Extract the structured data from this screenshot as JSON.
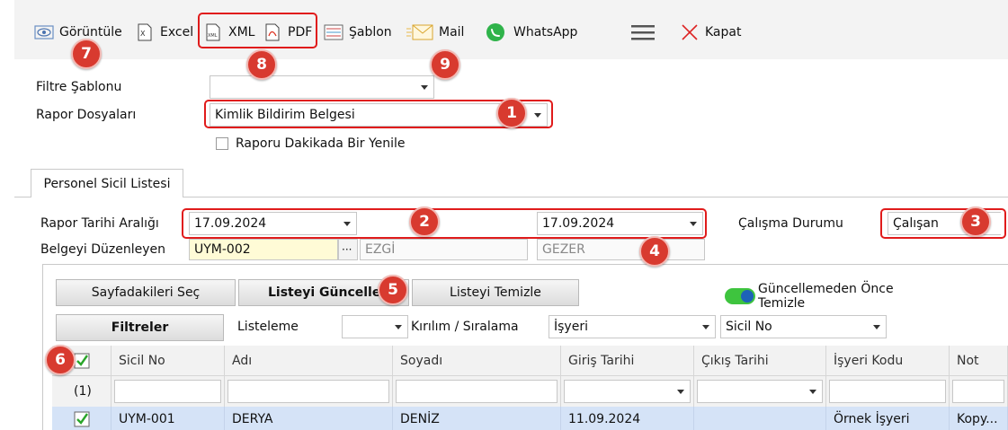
{
  "toolbar": {
    "view_label": "Görüntüle",
    "excel_label": "Excel",
    "xml_label": "XML",
    "pdf_label": "PDF",
    "template_label": "Şablon",
    "mail_label": "Mail",
    "whatsapp_label": "WhatsApp",
    "close_label": "Kapat",
    "icons": [
      "eye-icon",
      "excel-icon",
      "xml-file-icon",
      "pdf-file-icon",
      "template-icon",
      "mail-icon",
      "whatsapp-icon",
      "hamburger-menu-icon",
      "close-x-icon"
    ]
  },
  "badges": {
    "b1": "1",
    "b2": "2",
    "b3": "3",
    "b4": "4",
    "b5": "5",
    "b6": "6",
    "b7": "7",
    "b8": "8",
    "b9": "9"
  },
  "filters": {
    "filter_template_label": "Filtre Şablonu",
    "filter_template_value": "",
    "report_files_label": "Rapor Dosyaları",
    "report_files_value": "Kimlik Bildirim Belgesi",
    "refresh_label": "Raporu Dakikada Bir Yenile"
  },
  "tab": {
    "label": "Personel Sicil Listesi"
  },
  "form": {
    "date_range_label": "Rapor Tarihi Aralığı",
    "date_from": "17.09.2024",
    "date_to": "17.09.2024",
    "work_status_label": "Çalışma Durumu",
    "work_status_value": "Çalışan",
    "issuer_label": "Belgeyi Düzenleyen",
    "issuer_code": "UYM-002",
    "issuer_name": "EZGİ",
    "issuer_surname": "GEZER"
  },
  "actions": {
    "select_page": "Sayfadakileri Seç",
    "refresh_list": "Listeyi Güncelle",
    "clear_list": "Listeyi Temizle",
    "clear_before_update": "Güncellemeden Önce Temizle",
    "filters": "Filtreler",
    "listing_label": "Listeleme",
    "listing_value": "",
    "break_sort_label": "Kırılım / Sıralama",
    "break_value": "İşyeri",
    "sort_value": "Sicil No"
  },
  "grid": {
    "columns": [
      "Sicil No",
      "Adı",
      "Soyadı",
      "Giriş Tarihi",
      "Çıkış Tarihi",
      "İşyeri Kodu",
      "Not"
    ],
    "count": "(1)",
    "rows": [
      {
        "sicil": "UYM-001",
        "adi": "DERYA",
        "soyadi": "DENİZ",
        "giris": "11.09.2024",
        "cikis": "",
        "isyeri": "Örnek İşyeri",
        "not": "Kopy..."
      }
    ]
  },
  "colors": {
    "accent_red": "#d83a2f",
    "row_selected": "#d5e3f7",
    "toggle_on": "#3ec43e"
  }
}
